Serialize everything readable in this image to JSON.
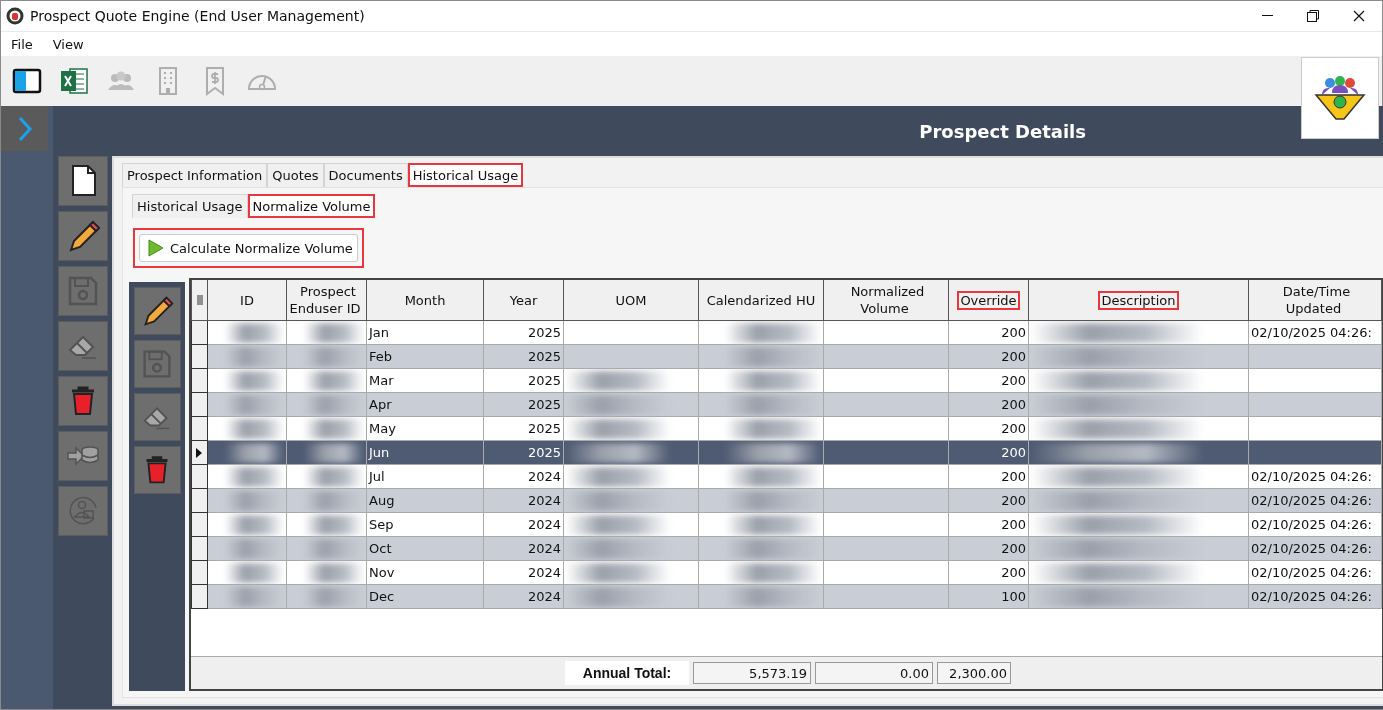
{
  "window": {
    "title": "Prospect Quote Engine (End User Management)"
  },
  "menu": [
    "File",
    "View"
  ],
  "toolbar": [
    {
      "disabled": false
    },
    {
      "disabled": false
    },
    {
      "disabled": true
    },
    {
      "disabled": true
    },
    {
      "disabled": true
    },
    {
      "disabled": true
    }
  ],
  "header": {
    "title": "Prospect Details"
  },
  "side_tools": [
    {
      "disabled": false
    },
    {
      "disabled": false
    },
    {
      "disabled": true
    },
    {
      "disabled": true
    },
    {
      "disabled": false
    },
    {
      "disabled": true
    },
    {
      "disabled": true
    }
  ],
  "tabs": [
    {
      "label": "Prospect Information",
      "selected": false,
      "highlighted": false
    },
    {
      "label": "Quotes",
      "selected": false,
      "highlighted": false
    },
    {
      "label": "Documents",
      "selected": false,
      "highlighted": false
    },
    {
      "label": "Historical Usage",
      "selected": true,
      "highlighted": true
    }
  ],
  "subtabs": [
    {
      "label": "Historical Usage",
      "selected": false,
      "highlighted": false
    },
    {
      "label": "Normalize Volume",
      "selected": true,
      "highlighted": true
    }
  ],
  "action_button": {
    "label": "Calculate Normalize Volume",
    "highlighted": true
  },
  "grid_tools": [
    {
      "disabled": false
    },
    {
      "disabled": true
    },
    {
      "disabled": true
    },
    {
      "disabled": false
    }
  ],
  "table": {
    "columns": [
      {
        "label": "ID",
        "highlighted": false
      },
      {
        "label": "Prospect Enduser ID",
        "highlighted": false
      },
      {
        "label": "Month",
        "highlighted": false
      },
      {
        "label": "Year",
        "highlighted": false
      },
      {
        "label": "UOM",
        "highlighted": false
      },
      {
        "label": "Calendarized HU",
        "highlighted": false
      },
      {
        "label": "Normalized Volume",
        "highlighted": false
      },
      {
        "label": "Override",
        "highlighted": true
      },
      {
        "label": "Description",
        "highlighted": true
      },
      {
        "label": "Date/Time Updated",
        "highlighted": false
      }
    ],
    "rows": [
      {
        "selected": false,
        "cells": [
          {
            "kind": "blurred"
          },
          {
            "kind": "blurred"
          },
          "Jan",
          "2025",
          "",
          {
            "kind": "blurred"
          },
          "",
          "200",
          {
            "kind": "blurred"
          },
          "02/10/2025 04:26:"
        ]
      },
      {
        "selected": false,
        "cells": [
          {
            "kind": "blurred"
          },
          {
            "kind": "blurred"
          },
          "Feb",
          "2025",
          "",
          {
            "kind": "blurred"
          },
          "",
          "200",
          {
            "kind": "blurred"
          },
          ""
        ]
      },
      {
        "selected": false,
        "cells": [
          {
            "kind": "blurred"
          },
          {
            "kind": "blurred"
          },
          "Mar",
          "2025",
          {
            "kind": "blurred"
          },
          {
            "kind": "blurred"
          },
          "",
          "200",
          {
            "kind": "blurred"
          },
          ""
        ]
      },
      {
        "selected": false,
        "cells": [
          {
            "kind": "blurred"
          },
          {
            "kind": "blurred"
          },
          "Apr",
          "2025",
          {
            "kind": "blurred"
          },
          {
            "kind": "blurred"
          },
          "",
          "200",
          {
            "kind": "blurred"
          },
          ""
        ]
      },
      {
        "selected": false,
        "cells": [
          {
            "kind": "blurred"
          },
          {
            "kind": "blurred"
          },
          "May",
          "2025",
          {
            "kind": "blurred"
          },
          {
            "kind": "blurred"
          },
          "",
          "200",
          {
            "kind": "blurred"
          },
          ""
        ]
      },
      {
        "selected": true,
        "cells": [
          {
            "kind": "blurred"
          },
          {
            "kind": "blurred"
          },
          "Jun",
          "2025",
          {
            "kind": "blurred"
          },
          {
            "kind": "blurred"
          },
          "",
          "200",
          {
            "kind": "blurred"
          },
          ""
        ]
      },
      {
        "selected": false,
        "cells": [
          {
            "kind": "blurred"
          },
          {
            "kind": "blurred"
          },
          "Jul",
          "2024",
          {
            "kind": "blurred"
          },
          {
            "kind": "blurred"
          },
          "",
          "200",
          {
            "kind": "blurred"
          },
          "02/10/2025 04:26:"
        ]
      },
      {
        "selected": false,
        "cells": [
          {
            "kind": "blurred"
          },
          {
            "kind": "blurred"
          },
          "Aug",
          "2024",
          {
            "kind": "blurred"
          },
          {
            "kind": "blurred"
          },
          "",
          "200",
          {
            "kind": "blurred"
          },
          "02/10/2025 04:26:"
        ]
      },
      {
        "selected": false,
        "cells": [
          {
            "kind": "blurred"
          },
          {
            "kind": "blurred"
          },
          "Sep",
          "2024",
          {
            "kind": "blurred"
          },
          {
            "kind": "blurred"
          },
          "",
          "200",
          {
            "kind": "blurred"
          },
          "02/10/2025 04:26:"
        ]
      },
      {
        "selected": false,
        "cells": [
          {
            "kind": "blurred"
          },
          {
            "kind": "blurred"
          },
          "Oct",
          "2024",
          {
            "kind": "blurred"
          },
          {
            "kind": "blurred"
          },
          "",
          "200",
          {
            "kind": "blurred"
          },
          "02/10/2025 04:26:"
        ]
      },
      {
        "selected": false,
        "cells": [
          {
            "kind": "blurred"
          },
          {
            "kind": "blurred"
          },
          "Nov",
          "2024",
          {
            "kind": "blurred"
          },
          {
            "kind": "blurred"
          },
          "",
          "200",
          {
            "kind": "blurred"
          },
          "02/10/2025 04:26:"
        ]
      },
      {
        "selected": false,
        "cells": [
          {
            "kind": "blurred"
          },
          {
            "kind": "blurred"
          },
          "Dec",
          "2024",
          {
            "kind": "blurred"
          },
          {
            "kind": "blurred"
          },
          "",
          "100",
          {
            "kind": "blurred"
          },
          "02/10/2025 04:26:"
        ]
      }
    ],
    "footer": {
      "label": "Annual Total:",
      "totals": [
        "5,573.19",
        "0.00",
        "2,300.00"
      ]
    }
  }
}
